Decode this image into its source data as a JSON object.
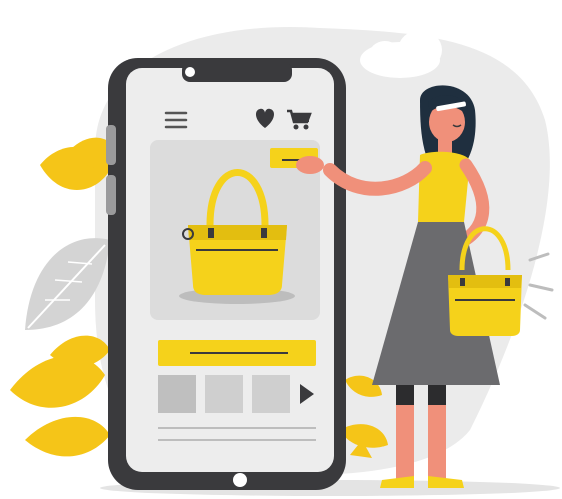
{
  "scene": {
    "kind": "illustration",
    "subject": "online-shopping"
  },
  "phone": {
    "nav_icons": [
      "hamburger-menu-icon",
      "heart-icon",
      "cart-icon"
    ],
    "product": "handbag",
    "thumbnail_count": 3,
    "next_icon": "play-arrow-icon"
  },
  "colors": {
    "accent_yellow": "#F5D21B",
    "phone_dark": "#3A3A3D",
    "screen_bg": "#EDEDED",
    "card_bg": "#DCDCDC",
    "skirt_gray": "#6B6B6E",
    "skin": "#F0907A",
    "hair": "#1F2F3F",
    "leaf_gray": "#D4D4D4",
    "background_blob": "#EBEBEB"
  }
}
